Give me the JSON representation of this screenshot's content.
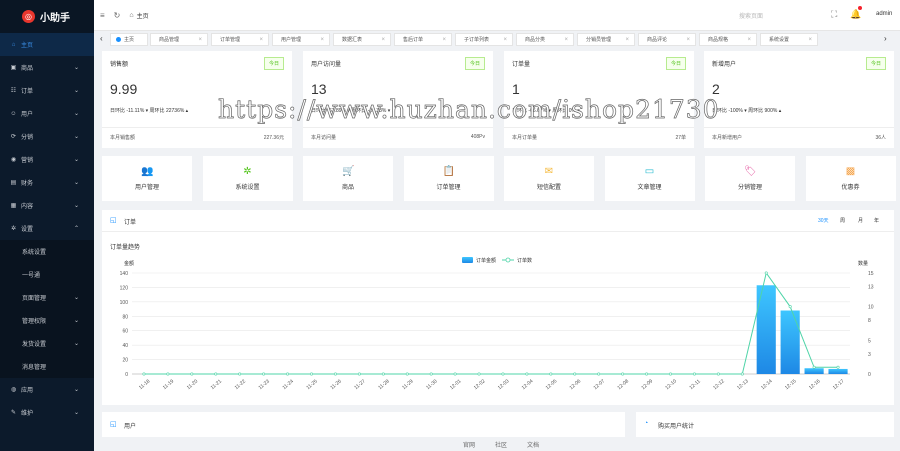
{
  "app": {
    "logo_text": "小助手"
  },
  "sidebar": {
    "items": [
      {
        "label": "主页",
        "icon": "home-icon",
        "glyph": "⌂",
        "active": true,
        "chev": false
      },
      {
        "label": "商品",
        "icon": "shop-icon",
        "glyph": "▣",
        "chev": true
      },
      {
        "label": "订单",
        "icon": "cart-icon",
        "glyph": "☷",
        "chev": true
      },
      {
        "label": "用户",
        "icon": "user-icon",
        "glyph": "☺",
        "chev": true
      },
      {
        "label": "分销",
        "icon": "share-icon",
        "glyph": "⟳",
        "chev": true
      },
      {
        "label": "营销",
        "icon": "chat-icon",
        "glyph": "◉",
        "chev": true
      },
      {
        "label": "财务",
        "icon": "finance-icon",
        "glyph": "▤",
        "chev": true
      },
      {
        "label": "内容",
        "icon": "content-icon",
        "glyph": "▦",
        "chev": true
      },
      {
        "label": "设置",
        "icon": "gear-icon",
        "glyph": "✲",
        "chev": true,
        "open": true
      }
    ],
    "sub_items": [
      {
        "label": "系统设置",
        "chev": false
      },
      {
        "label": "一号通",
        "chev": false
      },
      {
        "label": "页面管理",
        "chev": true
      },
      {
        "label": "管理权限",
        "chev": true
      },
      {
        "label": "发货设置",
        "chev": true
      },
      {
        "label": "消息管理",
        "chev": false
      }
    ],
    "bottom_items": [
      {
        "label": "应用",
        "icon": "app-icon",
        "glyph": "◍",
        "chev": true
      },
      {
        "label": "维护",
        "icon": "wrench-icon",
        "glyph": "✎",
        "chev": true
      }
    ]
  },
  "topbar": {
    "breadcrumb": "主页",
    "search_placeholder": "搜索页面",
    "user": "admin"
  },
  "tabs": [
    "主页",
    "商品管理",
    "订单管理",
    "用户管理",
    "数据汇表",
    "售后订单",
    "子订单列表",
    "商品分类",
    "分销员管理",
    "商品评论",
    "商品规格",
    "系统设置"
  ],
  "stats": [
    {
      "title": "销售额",
      "tag": "今日",
      "value": "9.99",
      "meta": "日环比 -11.11% ▾   周环比 22736% ▴",
      "foot_label": "本月销售额",
      "foot_value": "227.36元"
    },
    {
      "title": "用户访问量",
      "tag": "今日",
      "value": "13",
      "meta": "日环比 -63.89% ▾   周环比 -13.33% ▾",
      "foot_label": "本月访问量",
      "foot_value": "408Pv"
    },
    {
      "title": "订单量",
      "tag": "今日",
      "value": "1",
      "meta": "日环比 -66.67% ▾   周环比 0% ▾",
      "foot_label": "本月订单量",
      "foot_value": "27单"
    },
    {
      "title": "新增用户",
      "tag": "今日",
      "value": "2",
      "meta": "日环比 -100% ▾   周环比 900% ▴",
      "foot_label": "本月新增用户",
      "foot_value": "36人"
    }
  ],
  "quick": [
    {
      "label": "用户管理",
      "icon": "users-icon",
      "glyph": "👥",
      "color": "#3a8ee6"
    },
    {
      "label": "系统设置",
      "icon": "settings-icon",
      "glyph": "✲",
      "color": "#52c41a"
    },
    {
      "label": "商品",
      "icon": "cart-icon",
      "glyph": "🛒",
      "color": "#f5574b"
    },
    {
      "label": "订单管理",
      "icon": "clipboard-icon",
      "glyph": "📋",
      "color": "#9b59e6"
    },
    {
      "label": "短信配置",
      "icon": "mail-icon",
      "glyph": "✉",
      "color": "#f5b93b"
    },
    {
      "label": "文章管理",
      "icon": "card-icon",
      "glyph": "▭",
      "color": "#22b8cf"
    },
    {
      "label": "分销管理",
      "icon": "tag-icon",
      "glyph": "🏷",
      "color": "#e55fa4"
    },
    {
      "label": "优惠券",
      "icon": "coupon-icon",
      "glyph": "▩",
      "color": "#f5a44b"
    }
  ],
  "chart_panel": {
    "title": "订单",
    "ranges": [
      "30天",
      "周",
      "月",
      "年"
    ],
    "active_range": "30天"
  },
  "chart_data": {
    "type": "bar",
    "title": "订单量趋势",
    "ylabel": "金额",
    "y2label": "数量",
    "ylim": [
      0,
      140
    ],
    "y2lim": [
      0,
      15
    ],
    "yticks": [
      0,
      20,
      40,
      60,
      80,
      100,
      120,
      140
    ],
    "y2ticks": [
      0,
      3,
      5,
      8,
      10,
      13,
      15
    ],
    "categories": [
      "11-18",
      "11-19",
      "11-20",
      "11-21",
      "11-22",
      "11-23",
      "11-24",
      "11-25",
      "11-26",
      "11-27",
      "11-28",
      "11-29",
      "11-30",
      "12-01",
      "12-02",
      "12-03",
      "12-04",
      "12-05",
      "12-06",
      "12-07",
      "12-08",
      "12-09",
      "12-10",
      "12-11",
      "12-12",
      "12-13",
      "12-14",
      "12-15",
      "12-16",
      "12-17"
    ],
    "series": [
      {
        "name": "订单金额",
        "type": "bar",
        "axis": "left",
        "color": "#1e9fe8",
        "values": [
          0,
          0,
          0,
          0,
          0,
          0,
          0,
          0,
          0,
          0,
          0,
          0,
          0,
          0,
          0,
          0,
          0,
          0,
          0,
          0,
          0,
          0,
          0,
          0,
          0,
          0,
          123,
          88,
          8,
          7
        ]
      },
      {
        "name": "订单数",
        "type": "line",
        "axis": "right",
        "color": "#4fd4a8",
        "values": [
          0,
          0,
          0,
          0,
          0,
          0,
          0,
          0,
          0,
          0,
          0,
          0,
          0,
          0,
          0,
          0,
          0,
          0,
          0,
          0,
          0,
          0,
          0,
          0,
          0,
          0,
          15,
          10,
          1,
          1
        ]
      }
    ],
    "legend": "top-center"
  },
  "bottom": {
    "left_title": "用户",
    "right_title": "购买用户统计"
  },
  "footer": [
    "官网",
    "社区",
    "文档"
  ]
}
